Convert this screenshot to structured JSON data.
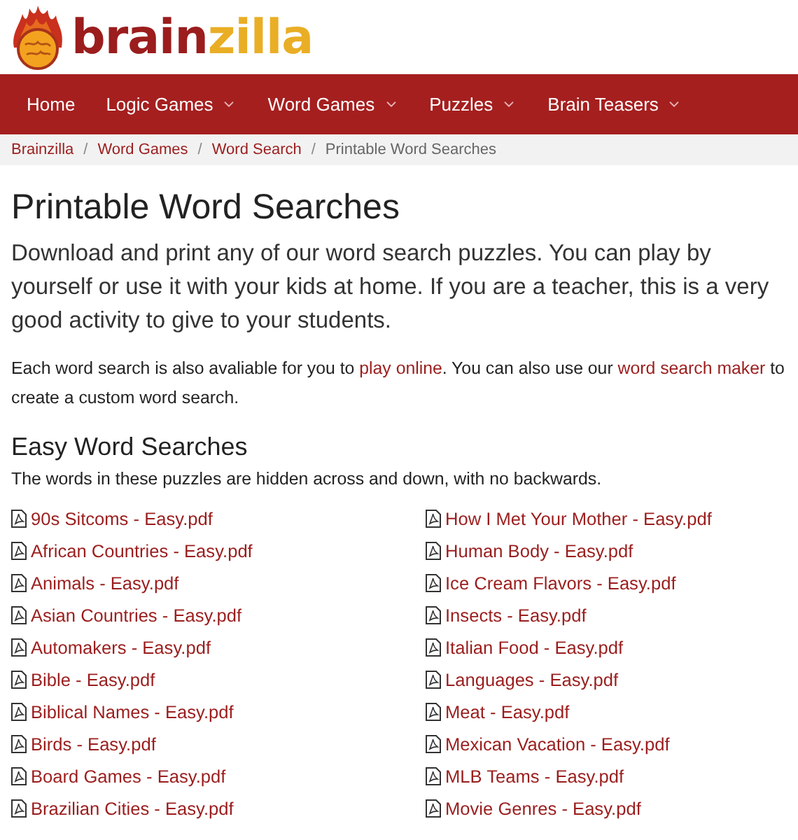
{
  "logo": {
    "words": [
      "brain",
      "zilla"
    ]
  },
  "nav": [
    {
      "label": "Home",
      "has_menu": false
    },
    {
      "label": "Logic Games",
      "has_menu": true
    },
    {
      "label": "Word Games",
      "has_menu": true
    },
    {
      "label": "Puzzles",
      "has_menu": true
    },
    {
      "label": "Brain Teasers",
      "has_menu": true
    }
  ],
  "breadcrumb_separator": "/",
  "breadcrumb": [
    {
      "label": "Brainzilla",
      "current": false
    },
    {
      "label": "Word Games",
      "current": false
    },
    {
      "label": "Word Search",
      "current": false
    },
    {
      "label": "Printable Word Searches",
      "current": true
    }
  ],
  "title": "Printable Word Searches",
  "intro": "Download and print any of our word search puzzles. You can play by yourself or use it with your kids at home. If you are a teacher, this is a very good activity to give to your students.",
  "note": [
    {
      "text": "Each word search is also avaliable for you to ",
      "link": false
    },
    {
      "text": "play online",
      "link": true
    },
    {
      "text": ". You can also use our ",
      "link": false
    },
    {
      "text": "word search maker",
      "link": true
    },
    {
      "text": " to create a custom word search.",
      "link": false
    }
  ],
  "section": {
    "heading": "Easy Word Searches",
    "description": "The words in these puzzles are hidden across and down, with no backwards.",
    "columns": [
      [
        "90s Sitcoms - Easy.pdf",
        "African Countries - Easy.pdf",
        "Animals - Easy.pdf",
        "Asian Countries - Easy.pdf",
        "Automakers - Easy.pdf",
        "Bible - Easy.pdf",
        "Biblical Names - Easy.pdf",
        "Birds - Easy.pdf",
        "Board Games - Easy.pdf",
        "Brazilian Cities - Easy.pdf"
      ],
      [
        "How I Met Your Mother - Easy.pdf",
        "Human Body - Easy.pdf",
        "Ice Cream Flavors - Easy.pdf",
        "Insects - Easy.pdf",
        "Italian Food - Easy.pdf",
        "Languages - Easy.pdf",
        "Meat - Easy.pdf",
        "Mexican Vacation - Easy.pdf",
        "MLB Teams - Easy.pdf",
        "Movie Genres - Easy.pdf"
      ]
    ]
  }
}
